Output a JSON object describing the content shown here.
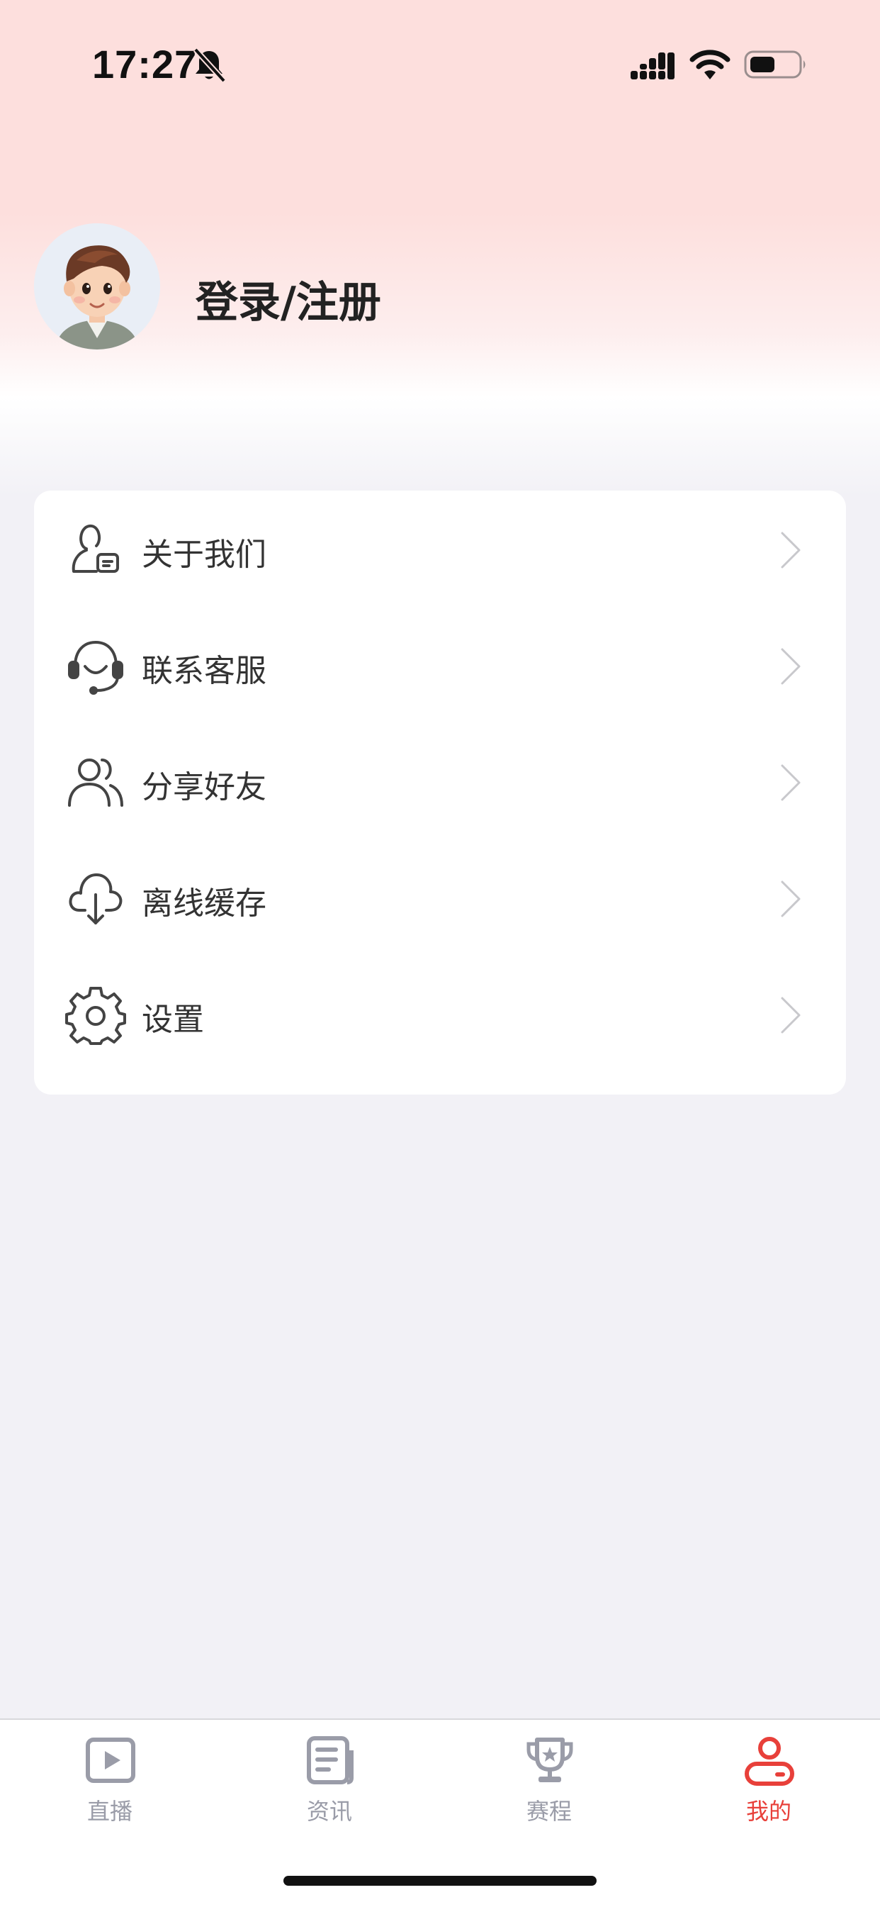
{
  "status_bar": {
    "time": "17:27",
    "icons": [
      "bell-slash-icon",
      "cellular-signal-icon",
      "wifi-icon",
      "battery-icon"
    ]
  },
  "profile": {
    "avatar_icon": "cartoon-boy-avatar",
    "login_label": "登录/注册"
  },
  "menu": {
    "items": [
      {
        "label": "关于我们",
        "icon": "about-us-icon"
      },
      {
        "label": "联系客服",
        "icon": "headset-icon"
      },
      {
        "label": "分享好友",
        "icon": "users-icon"
      },
      {
        "label": "离线缓存",
        "icon": "cloud-download-icon"
      },
      {
        "label": "设置",
        "icon": "gear-icon"
      }
    ]
  },
  "tab_bar": {
    "tabs": [
      {
        "label": "直播",
        "icon": "play-icon",
        "active": false
      },
      {
        "label": "资讯",
        "icon": "news-icon",
        "active": false
      },
      {
        "label": "赛程",
        "icon": "trophy-icon",
        "active": false
      },
      {
        "label": "我的",
        "icon": "profile-icon",
        "active": true
      }
    ]
  },
  "colors": {
    "accent": "#e8403a",
    "inactive_tab": "#9a9ca8",
    "header_pink": "#fddfdd",
    "page_background": "#f2f1f6"
  }
}
